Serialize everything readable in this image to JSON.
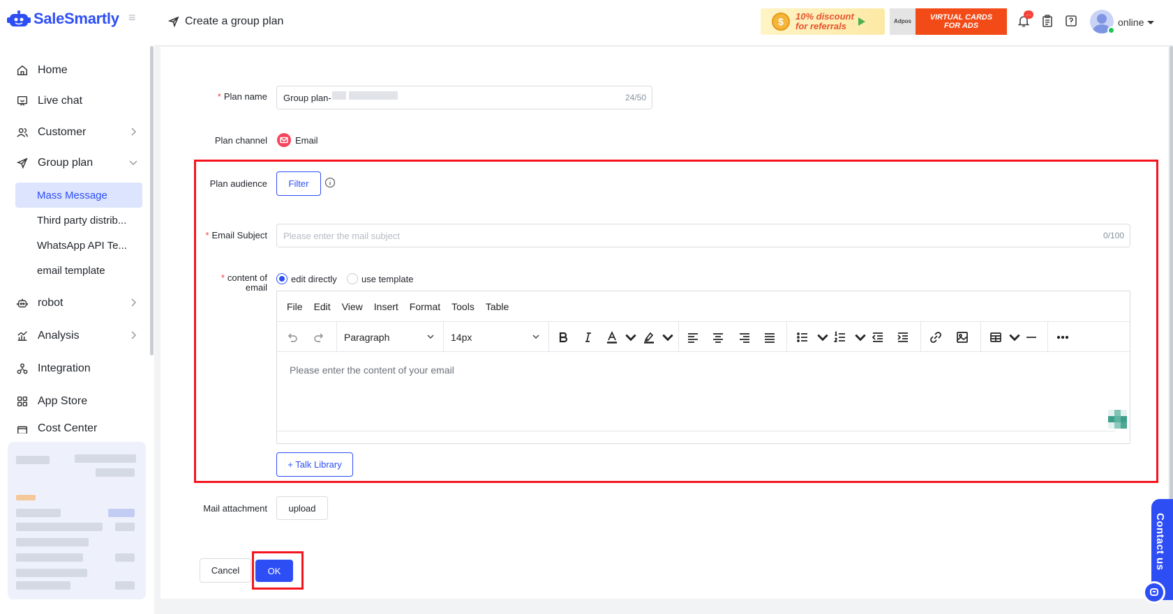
{
  "brand": {
    "name": "SaleSmartly",
    "color": "#2d4ef5"
  },
  "sidebar": {
    "items": [
      {
        "label": "Home",
        "icon": "home-icon"
      },
      {
        "label": "Live chat",
        "icon": "chat-icon"
      },
      {
        "label": "Customer",
        "icon": "users-icon"
      },
      {
        "label": "Group plan",
        "icon": "send-icon"
      },
      {
        "label": "robot",
        "icon": "robot-icon"
      },
      {
        "label": "Analysis",
        "icon": "chart-icon"
      },
      {
        "label": "Integration",
        "icon": "integration-icon"
      },
      {
        "label": "App Store",
        "icon": "grid-icon"
      },
      {
        "label": "Cost Center",
        "icon": "wallet-icon"
      }
    ],
    "group_plan_subitems": [
      "Mass Message",
      "Third party distrib...",
      "WhatsApp API Te...",
      "email template"
    ]
  },
  "header": {
    "page_title": "Create a group plan",
    "banner_referral": "10% discount for referrals",
    "banner_referral_line1": "10% discount",
    "banner_referral_line2": "for referrals",
    "banner_adpos": "Adpos",
    "banner_virtual_line1": "VIRTUAL CARDS",
    "banner_virtual_line2": "FOR ADS",
    "notification_badge": "...",
    "status": "online"
  },
  "form": {
    "plan_name": {
      "label": "Plan name",
      "value": "Group plan-",
      "counter": "24/50"
    },
    "plan_channel": {
      "label": "Plan channel",
      "value": "Email"
    },
    "plan_audience": {
      "label": "Plan audience",
      "button": "Filter"
    },
    "email_subject": {
      "label": "Email Subject",
      "placeholder": "Please enter the mail subject",
      "counter": "0/100"
    },
    "content": {
      "label_line1": "content of",
      "label_line2": "email",
      "option_direct": "edit directly",
      "option_template": "use template",
      "selected": "edit directly"
    },
    "editor": {
      "menus": [
        "File",
        "Edit",
        "View",
        "Insert",
        "Format",
        "Tools",
        "Table"
      ],
      "block_format": "Paragraph",
      "font_size": "14px",
      "body_placeholder": "Please enter the content of your email"
    },
    "talk_library": "+ Talk Library",
    "mail_attachment": {
      "label": "Mail attachment",
      "button": "upload"
    },
    "cancel": "Cancel",
    "ok": "OK"
  },
  "contact_us": "Contact us",
  "colors": {
    "accent": "#2d4ef5",
    "highlight": "#f5141e",
    "required": "#f53f3f"
  }
}
